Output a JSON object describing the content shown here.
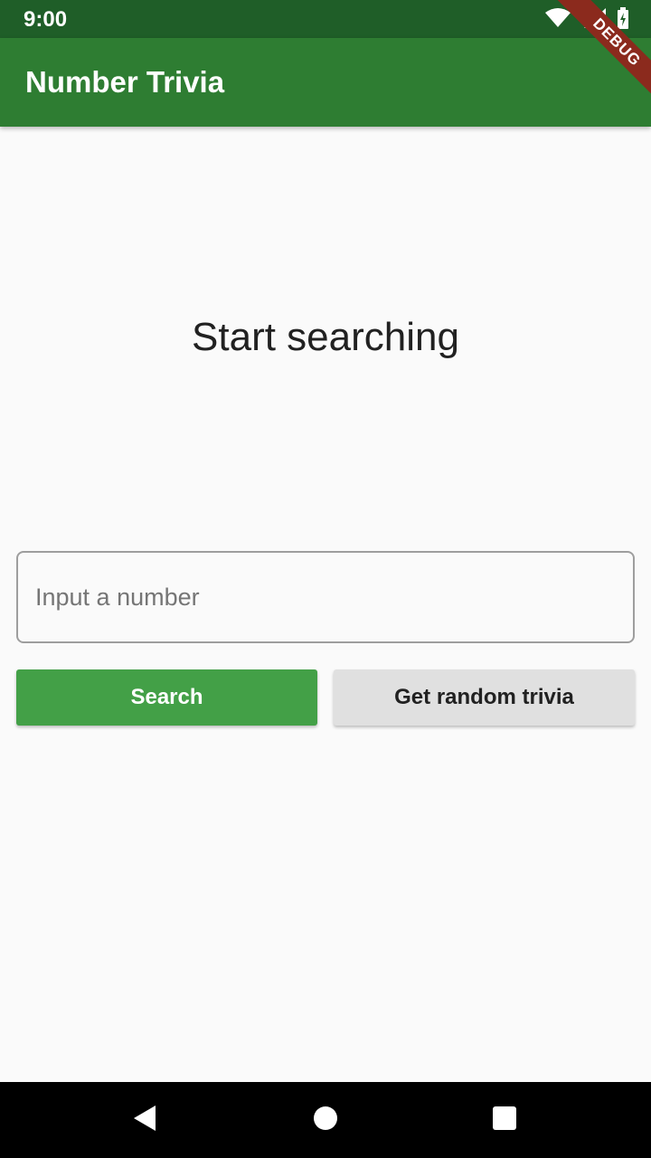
{
  "status_bar": {
    "time": "9:00",
    "icons": [
      "wifi-icon",
      "signal-icon",
      "battery-charging-icon"
    ]
  },
  "app_bar": {
    "title": "Number Trivia"
  },
  "debug_ribbon": {
    "label": "DEBUG"
  },
  "main": {
    "message": "Start searching",
    "input": {
      "placeholder": "Input a number",
      "value": ""
    },
    "search_button_label": "Search",
    "random_button_label": "Get random trivia"
  },
  "nav_bar": {
    "buttons": [
      "back-icon",
      "home-icon",
      "recents-icon"
    ]
  },
  "colors": {
    "status_bar": "#1f5e28",
    "app_bar": "#2e7d32",
    "search_button": "#43a047",
    "random_button": "#e0e0e0",
    "background": "#fafafa",
    "debug_ribbon": "#8b2a1d"
  }
}
